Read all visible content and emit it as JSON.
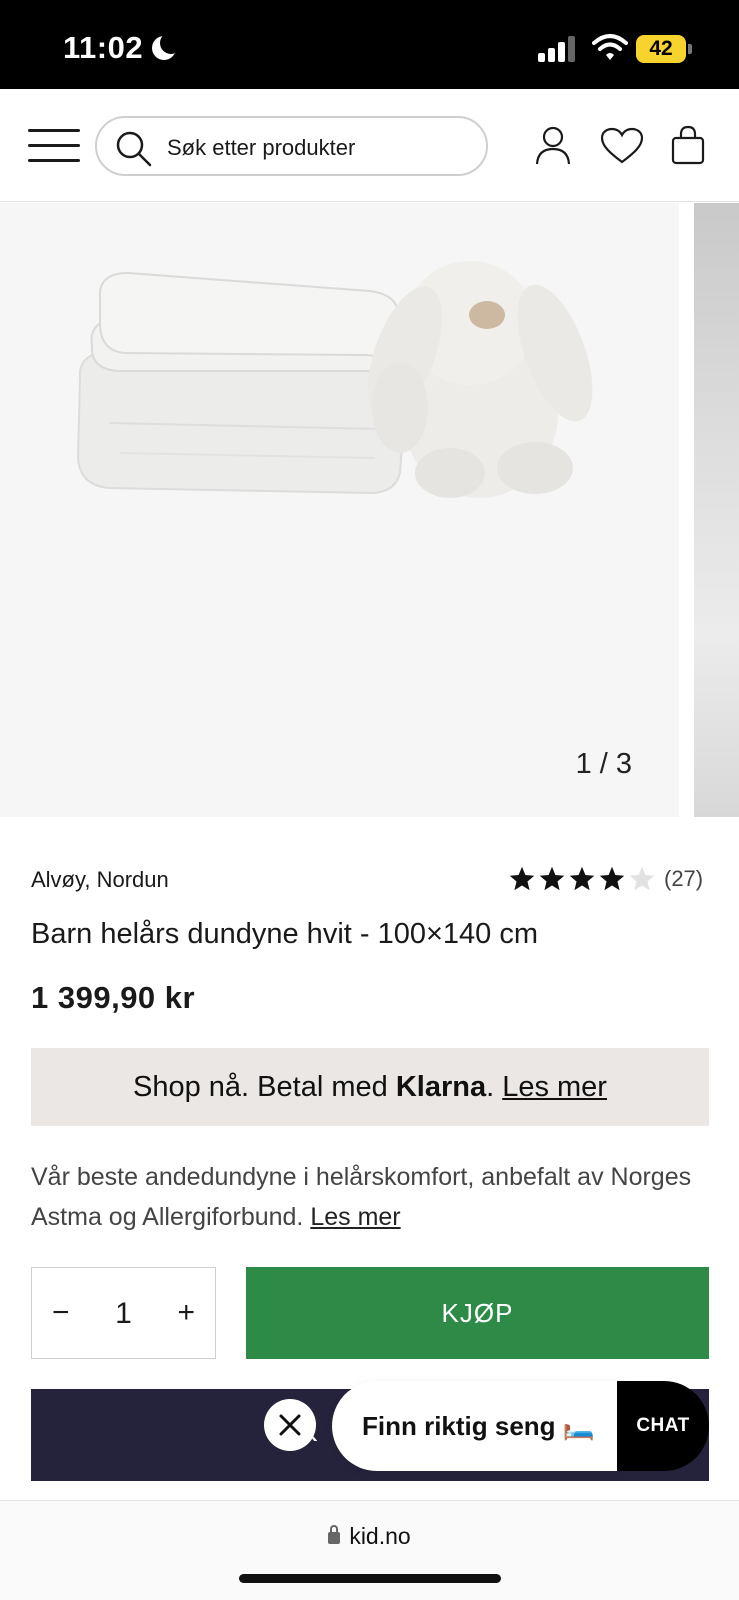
{
  "status_bar": {
    "time": "11:02",
    "battery": "42",
    "icons": [
      "moon-icon",
      "signal-icon",
      "wifi-icon",
      "battery-icon"
    ]
  },
  "header": {
    "search_placeholder": "Søk etter produkter",
    "icons": [
      "menu-icon",
      "search-icon",
      "account-icon",
      "heart-icon",
      "bag-icon"
    ]
  },
  "gallery": {
    "counter": "1 / 3"
  },
  "product": {
    "brand": "Alvøy, Nordun",
    "rating": 4,
    "rating_max": 5,
    "review_count": "(27)",
    "title": "Barn helårs dundyne hvit - 100×140 cm",
    "price": "1 399,90 kr"
  },
  "klarna": {
    "prefix": "Shop nå. Betal med ",
    "brand": "Klarna",
    "suffix": ". ",
    "link": "Les mer"
  },
  "description": {
    "text": "Vår beste andedundyne i helårskomfort, anbefalt av Norges Astma og Allergiforbund. ",
    "link": "Les mer"
  },
  "purchase": {
    "minus": "−",
    "quantity": "1",
    "plus": "+",
    "buy_label": "KJØP"
  },
  "secondary_button": {
    "label": "IK"
  },
  "chat_widget": {
    "close": "✕",
    "prompt": "Finn riktig seng 🛏️",
    "chat_label": "CHAT"
  },
  "browser": {
    "url": "kid.no"
  },
  "colors": {
    "buy_green": "#2e8b47",
    "dark_navy": "#25233b",
    "klarna_bg": "#ebe7e4"
  }
}
